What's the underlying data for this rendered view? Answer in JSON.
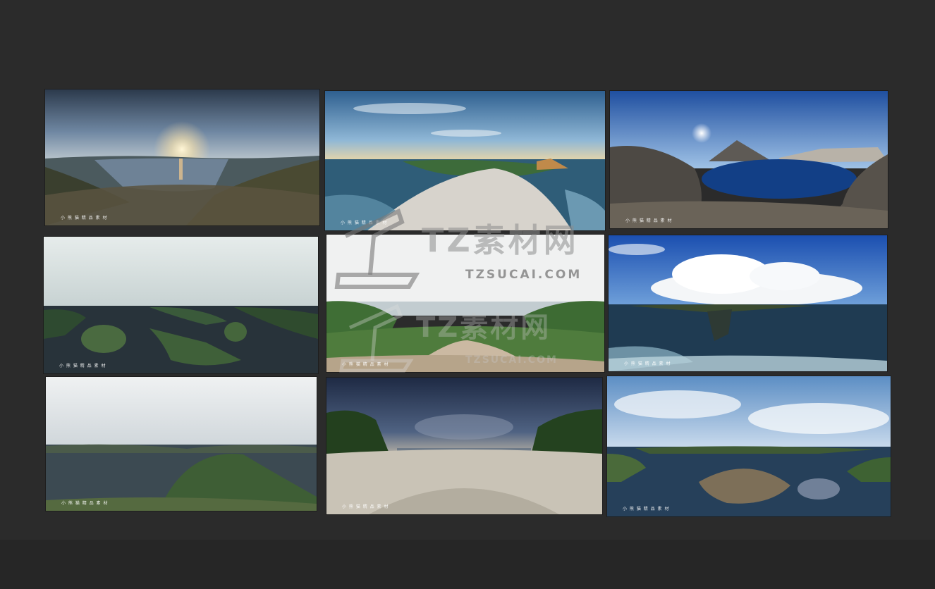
{
  "panoramas": [
    {
      "caption": "小 熊 猫 精 品 素 材"
    },
    {
      "caption": "小 熊 猫 精 品 素 材"
    },
    {
      "caption": "小 熊 猫 精 品 素 材"
    },
    {
      "caption": "小 熊 猫 精 品 素 材"
    },
    {
      "caption": "小 熊 猫 精 品 素 材"
    },
    {
      "caption": "小 熊 猫 精 品 素 材"
    },
    {
      "caption": "小 熊 猫 精 品 素 材"
    },
    {
      "caption": "小 熊 猫 精 品 素 材"
    },
    {
      "caption": "小 熊 猫 精 品 素 材"
    }
  ],
  "watermark": {
    "brand": "TZ素材网",
    "url": "TZSUCAI.COM"
  },
  "colors": {
    "background": "#2b2b2b",
    "bottom_band": "#262626"
  }
}
